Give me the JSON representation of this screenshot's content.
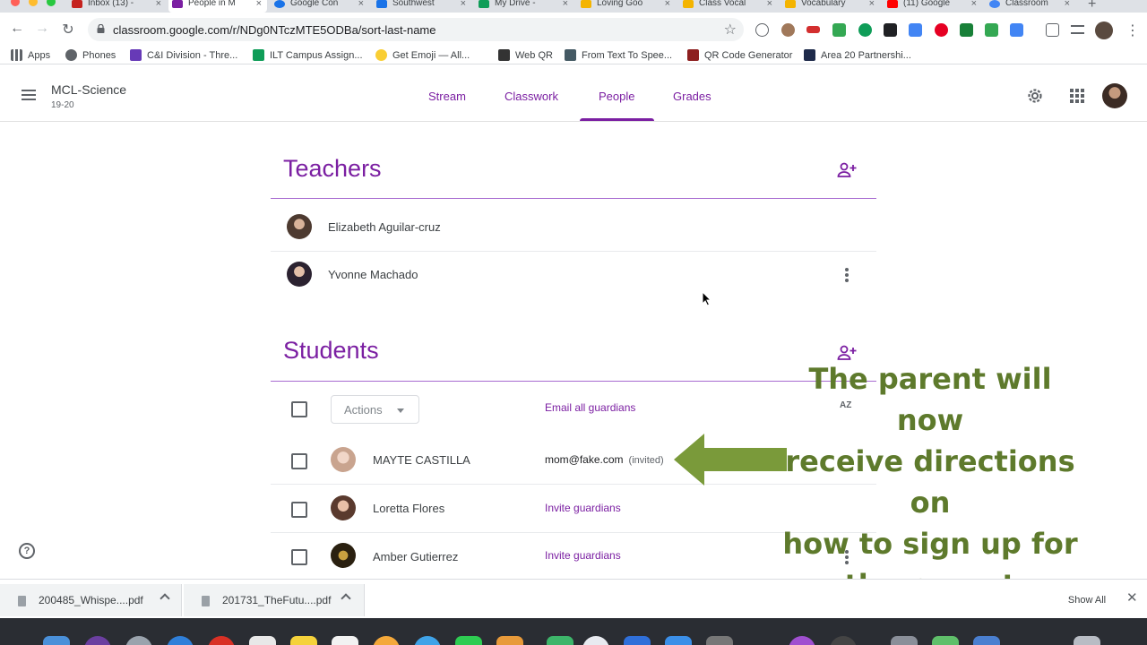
{
  "colors": {
    "classroom_purple": "#7b1fa2",
    "overlay_green": "#5e7a2c",
    "arrow_green": "#7a9a3a"
  },
  "browser": {
    "tabs": [
      {
        "title": "Inbox (13) -",
        "icon": "gmail-icon",
        "color": "#c5221f"
      },
      {
        "title": "People in M",
        "icon": "classroom-people-icon",
        "color": "#7b1fa2",
        "active": true
      },
      {
        "title": "Google Con",
        "icon": "contacts-icon",
        "color": "#1a73e8"
      },
      {
        "title": "Southwest",
        "icon": "calendar-icon",
        "color": "#1a73e8"
      },
      {
        "title": "My Drive -",
        "icon": "drive-icon",
        "color": "#0f9d58"
      },
      {
        "title": "Loving Goo",
        "icon": "slides-icon",
        "color": "#f4b400"
      },
      {
        "title": "Class Vocal",
        "icon": "slides-icon",
        "color": "#f4b400"
      },
      {
        "title": "Vocabulary",
        "icon": "slides-icon",
        "color": "#f4b400"
      },
      {
        "title": "(11) Google",
        "icon": "youtube-icon",
        "color": "#ff0000"
      },
      {
        "title": "Classroom",
        "icon": "google-icon",
        "color": "#4285f4"
      }
    ],
    "url": "classroom.google.com/r/NDg0NTczMTE5ODBa/sort-last-name",
    "bookmarks": [
      {
        "label": "Apps",
        "icon": "apps-grid-icon",
        "color": "#5f6368"
      },
      {
        "label": "Phones",
        "icon": "globe-icon",
        "color": "#5f6368"
      },
      {
        "label": "C&I Division - Thre...",
        "icon": "forms-icon",
        "color": "#673ab7"
      },
      {
        "label": "ILT Campus Assign...",
        "icon": "sheets-icon",
        "color": "#0f9d58"
      },
      {
        "label": "Get Emoji — All...",
        "icon": "emoji-icon",
        "color": "#f9ce34"
      },
      {
        "label": "Web QR",
        "icon": "qr-icon",
        "color": "#333333"
      },
      {
        "label": "From Text To Spee...",
        "icon": "tts-icon",
        "color": "#455a64"
      },
      {
        "label": "QR Code Generator",
        "icon": "qr-generator-icon",
        "color": "#8d1f1f"
      },
      {
        "label": "Area 20 Partnershi...",
        "icon": "area20-icon",
        "color": "#1e2a4a"
      }
    ]
  },
  "header": {
    "class_name": "MCL-Science",
    "class_section": "19-20",
    "tabs": [
      {
        "label": "Stream"
      },
      {
        "label": "Classwork"
      },
      {
        "label": "People",
        "active": true
      },
      {
        "label": "Grades"
      }
    ]
  },
  "teachers": {
    "title": "Teachers",
    "list": [
      {
        "name": "Elizabeth Aguilar-cruz"
      },
      {
        "name": "Yvonne Machado"
      }
    ]
  },
  "students": {
    "title": "Students",
    "actions_label": "Actions",
    "email_all_label": "Email all guardians",
    "sort_label": "AZ",
    "list": [
      {
        "name": "MAYTE CASTILLA",
        "guardian_email": "mom@fake.com",
        "guardian_status": "(invited)"
      },
      {
        "name": "Loretta Flores",
        "guardian_link": "Invite guardians"
      },
      {
        "name": "Amber Gutierrez",
        "guardian_link": "Invite guardians"
      }
    ]
  },
  "overlay": {
    "line1": "The parent will now",
    "line2": "receive directions on",
    "line3": "how to sign up for",
    "line4": "the parent summary."
  },
  "help_label": "?",
  "downloads": {
    "items": [
      {
        "name": "200485_Whispe....pdf"
      },
      {
        "name": "201731_TheFutu....pdf"
      }
    ],
    "show_all_label": "Show All"
  }
}
